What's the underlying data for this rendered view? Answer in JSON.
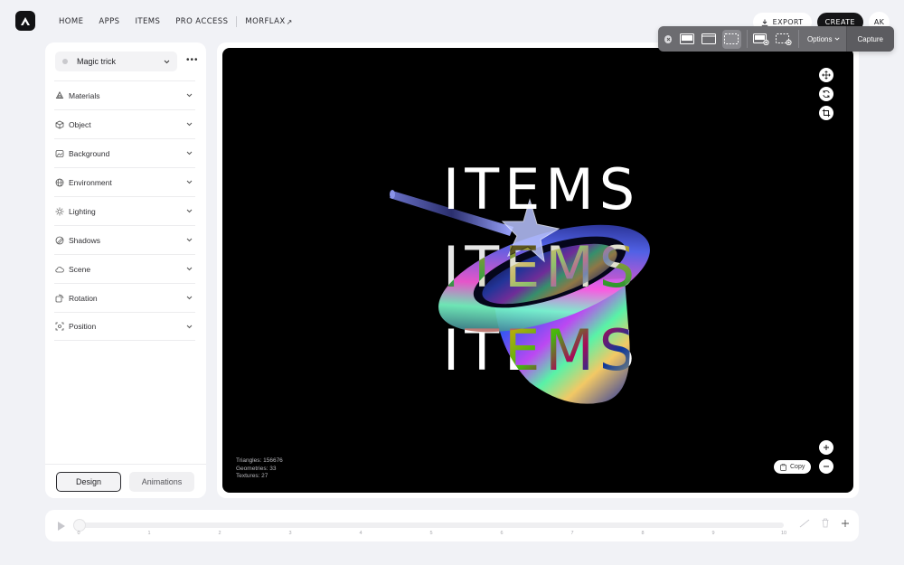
{
  "nav": {
    "items": [
      "HOME",
      "APPS",
      "ITEMS",
      "PRO ACCESS"
    ],
    "external": "MORFLAX",
    "external_icon": "arrow-up-right-icon"
  },
  "actions": {
    "export": "EXPORT",
    "create": "CREATE",
    "avatar": "AK"
  },
  "capture": {
    "options": "Options",
    "capture": "Capture"
  },
  "preset": {
    "label": "Magic trick"
  },
  "sections": [
    {
      "label": "Materials",
      "icon": "materials-icon"
    },
    {
      "label": "Object",
      "icon": "cube-icon"
    },
    {
      "label": "Background",
      "icon": "image-icon"
    },
    {
      "label": "Environment",
      "icon": "globe-icon"
    },
    {
      "label": "Lighting",
      "icon": "sun-icon"
    },
    {
      "label": "Shadows",
      "icon": "shadow-icon"
    },
    {
      "label": "Scene",
      "icon": "cloud-icon"
    },
    {
      "label": "Rotation",
      "icon": "rotate-icon"
    },
    {
      "label": "Position",
      "icon": "position-icon"
    }
  ],
  "tabs": {
    "design": "Design",
    "animations": "Animations"
  },
  "scene": {
    "text": "ITEMS"
  },
  "stats": {
    "triangles": "Triangles: 156676",
    "geometries": "Geometries: 33",
    "textures": "Textures: 27"
  },
  "copy": "Copy",
  "timeline": {
    "ticks": [
      "0",
      "1",
      "2",
      "3",
      "4",
      "5",
      "6",
      "7",
      "8",
      "9",
      "10"
    ]
  }
}
